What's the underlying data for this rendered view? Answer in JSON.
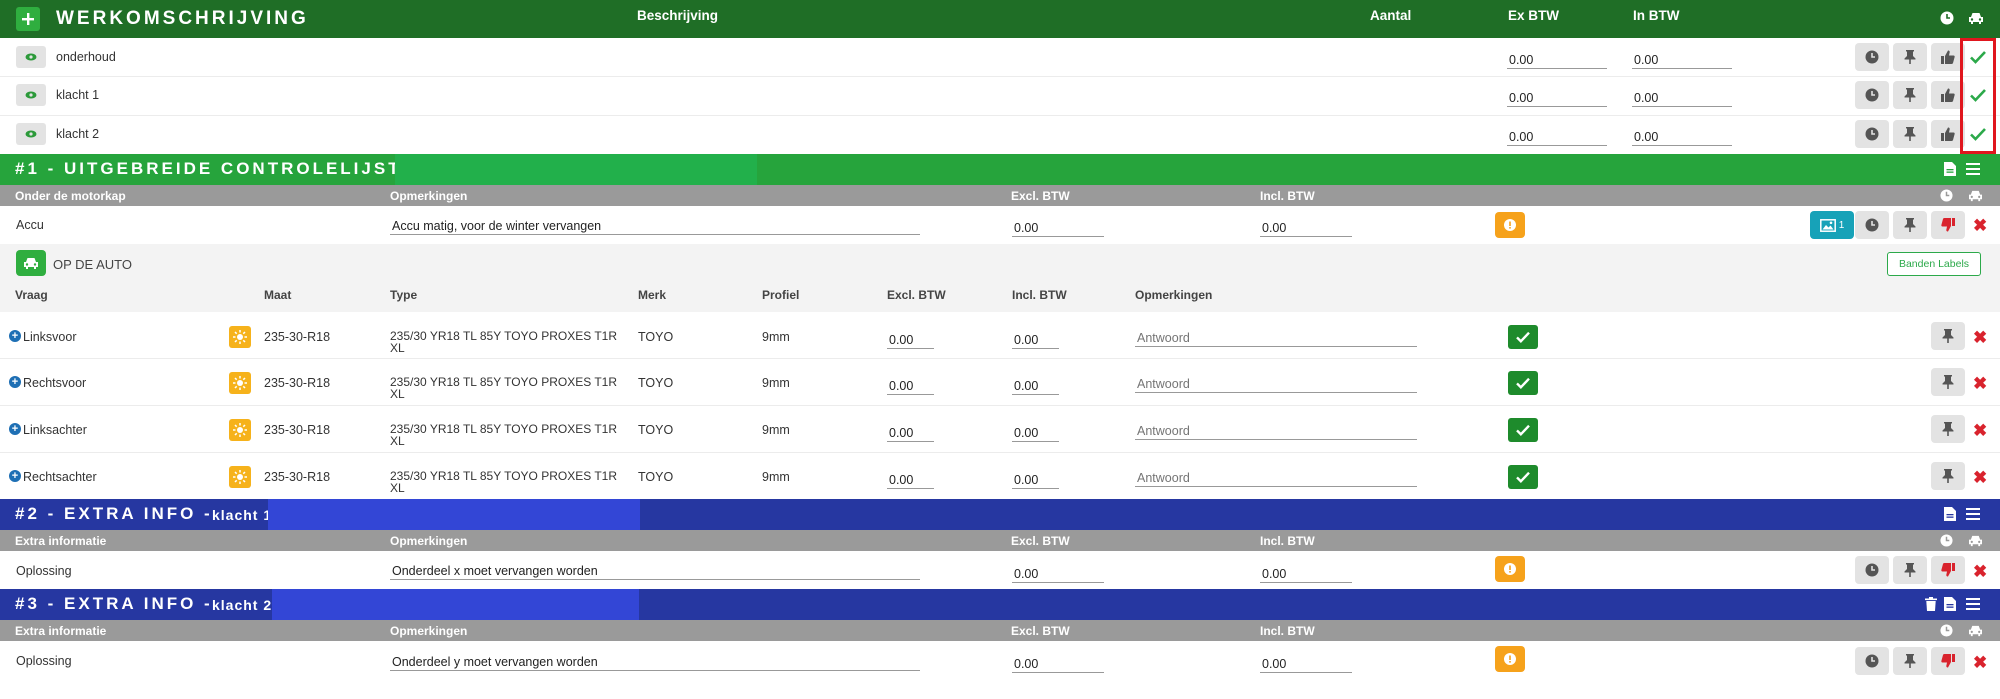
{
  "colors": {
    "green_header": "#1f6e26",
    "green_section": "#26a43c",
    "green_highlight": "#22b04b",
    "blue_section": "#2637a1",
    "blue_highlight": "#3346d6",
    "gray_header": "#9a9a9a",
    "warning": "#f6a21b",
    "ok_green": "#1e8b2c",
    "teal": "#17a2b8",
    "red": "#d9232d",
    "annotation_box": "#e0161e"
  },
  "werk": {
    "title": "WERKOMSCHRIJVING",
    "add_icon": "plus-icon",
    "col_beschrijving": "Beschrijving",
    "col_aantal": "Aantal",
    "col_ex_btw": "Ex BTW",
    "col_in_btw": "In BTW",
    "rows": [
      {
        "label": "onderhoud",
        "ex": "0.00",
        "in": "0.00"
      },
      {
        "label": "klacht 1",
        "ex": "0.00",
        "in": "0.00"
      },
      {
        "label": "klacht 2",
        "ex": "0.00",
        "in": "0.00"
      }
    ]
  },
  "s1": {
    "title": "#1 - UITGEBREIDE CONTROLELIJST -",
    "col_section": "Onder de motorkap",
    "col_opm": "Opmerkingen",
    "col_excl": "Excl. BTW",
    "col_incl": "Incl. BTW",
    "accu": {
      "label": "Accu",
      "remark": "Accu matig, voor de winter vervangen",
      "excl": "0.00",
      "incl": "0.00",
      "photo_count": "1"
    },
    "auto_label": "OP DE AUTO",
    "banden_button": "Banden Labels",
    "tyre_cols": {
      "vraag": "Vraag",
      "maat": "Maat",
      "type": "Type",
      "merk": "Merk",
      "profiel": "Profiel",
      "excl": "Excl. BTW",
      "incl": "Incl. BTW",
      "opm": "Opmerkingen"
    },
    "tyres": [
      {
        "vraag": "Linksvoor",
        "maat": "235-30-R18",
        "type1": "235/30 YR18 TL 85Y TOYO PROXES T1R",
        "type2": "XL",
        "merk": "TOYO",
        "profiel": "9mm",
        "excl": "0.00",
        "incl": "0.00",
        "placeholder": "Antwoord"
      },
      {
        "vraag": "Rechtsvoor",
        "maat": "235-30-R18",
        "type1": "235/30 YR18 TL 85Y TOYO PROXES T1R",
        "type2": "XL",
        "merk": "TOYO",
        "profiel": "9mm",
        "excl": "0.00",
        "incl": "0.00",
        "placeholder": "Antwoord"
      },
      {
        "vraag": "Linksachter",
        "maat": "235-30-R18",
        "type1": "235/30 YR18 TL 85Y TOYO PROXES T1R",
        "type2": "XL",
        "merk": "TOYO",
        "profiel": "9mm",
        "excl": "0.00",
        "incl": "0.00",
        "placeholder": "Antwoord"
      },
      {
        "vraag": "Rechtsachter",
        "maat": "235-30-R18",
        "type1": "235/30 YR18 TL 85Y TOYO PROXES T1R",
        "type2": "XL",
        "merk": "TOYO",
        "profiel": "9mm",
        "excl": "0.00",
        "incl": "0.00",
        "placeholder": "Antwoord"
      }
    ]
  },
  "s2": {
    "title": "#2 - EXTRA INFO -",
    "subtitle": "klacht 1",
    "col_section": "Extra informatie",
    "col_opm": "Opmerkingen",
    "col_excl": "Excl. BTW",
    "col_incl": "Incl. BTW",
    "row": {
      "label": "Oplossing",
      "remark": "Onderdeel x moet vervangen worden",
      "excl": "0.00",
      "incl": "0.00"
    }
  },
  "s3": {
    "title": "#3 - EXTRA INFO -",
    "subtitle": "klacht 2",
    "col_section": "Extra informatie",
    "col_opm": "Opmerkingen",
    "col_excl": "Excl. BTW",
    "col_incl": "Incl. BTW",
    "row": {
      "label": "Oplossing",
      "remark": "Onderdeel y moet vervangen worden",
      "excl": "0.00",
      "incl": "0.00"
    }
  }
}
